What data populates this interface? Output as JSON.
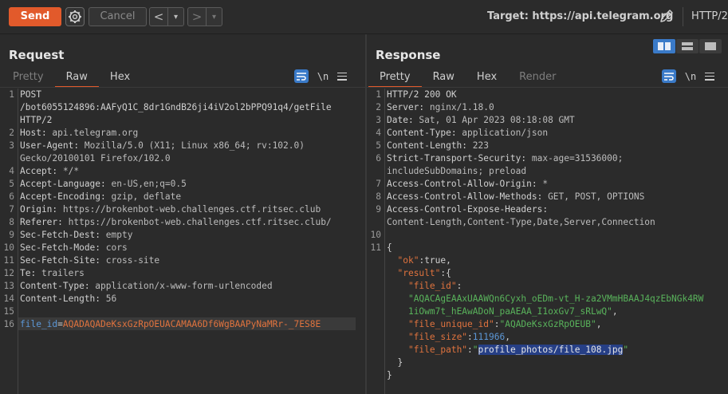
{
  "toolbar": {
    "send_label": "Send",
    "cancel_label": "Cancel",
    "back_label": "<",
    "forward_label": ">",
    "dropdown_glyph": "▾",
    "target_label": "Target: https://api.telegram.org",
    "http_version": "HTTP/2"
  },
  "request": {
    "title": "Request",
    "tabs": [
      "Pretty",
      "Raw",
      "Hex"
    ],
    "active_tab": "Raw",
    "newline_icon": "\\n",
    "lines": [
      {
        "n": "1",
        "k": "POST",
        "v": ""
      },
      {
        "n": "",
        "k": "/bot6055124896:AAFyQ1C_8dr1GndB26ji4iV2ol2bPPQ91q4/getFile",
        "v": ""
      },
      {
        "n": "",
        "k": "HTTP/2",
        "v": ""
      },
      {
        "n": "2",
        "k": "Host:",
        "v": " api.telegram.org"
      },
      {
        "n": "3",
        "k": "User-Agent:",
        "v": " Mozilla/5.0 (X11; Linux x86_64; rv:102.0)"
      },
      {
        "n": "",
        "k": "",
        "v": "Gecko/20100101 Firefox/102.0"
      },
      {
        "n": "4",
        "k": "Accept:",
        "v": " */*"
      },
      {
        "n": "5",
        "k": "Accept-Language:",
        "v": " en-US,en;q=0.5"
      },
      {
        "n": "6",
        "k": "Accept-Encoding:",
        "v": " gzip, deflate"
      },
      {
        "n": "7",
        "k": "Origin:",
        "v": " https://brokenbot-web.challenges.ctf.ritsec.club"
      },
      {
        "n": "8",
        "k": "Referer:",
        "v": " https://brokenbot-web.challenges.ctf.ritsec.club/"
      },
      {
        "n": "9",
        "k": "Sec-Fetch-Dest:",
        "v": " empty"
      },
      {
        "n": "10",
        "k": "Sec-Fetch-Mode:",
        "v": " cors"
      },
      {
        "n": "11",
        "k": "Sec-Fetch-Site:",
        "v": " cross-site"
      },
      {
        "n": "12",
        "k": "Te:",
        "v": " trailers"
      },
      {
        "n": "13",
        "k": "Content-Type:",
        "v": " application/x-www-form-urlencoded"
      },
      {
        "n": "14",
        "k": "Content-Length:",
        "v": " 56"
      },
      {
        "n": "15",
        "k": "",
        "v": ""
      }
    ],
    "body_line": {
      "n": "16",
      "param_name": "file_id",
      "equals": "=",
      "param_value": "AQADAQADeKsxGzRpOEUACAMAA6Df6WgBAAPyNaMRr-_7ES8E"
    }
  },
  "response": {
    "title": "Response",
    "tabs": [
      "Pretty",
      "Raw",
      "Hex",
      "Render"
    ],
    "active_tab": "Pretty",
    "newline_icon": "\\n",
    "header_lines": [
      {
        "n": "1",
        "k": "HTTP/2 200 OK",
        "v": ""
      },
      {
        "n": "2",
        "k": "Server:",
        "v": " nginx/1.18.0"
      },
      {
        "n": "3",
        "k": "Date:",
        "v": " Sat, 01 Apr 2023 08:18:08 GMT"
      },
      {
        "n": "4",
        "k": "Content-Type:",
        "v": " application/json"
      },
      {
        "n": "5",
        "k": "Content-Length:",
        "v": " 223"
      },
      {
        "n": "6",
        "k": "Strict-Transport-Security:",
        "v": " max-age=31536000;"
      },
      {
        "n": "",
        "k": "",
        "v": "includeSubDomains; preload"
      },
      {
        "n": "7",
        "k": "Access-Control-Allow-Origin:",
        "v": " *"
      },
      {
        "n": "8",
        "k": "Access-Control-Allow-Methods:",
        "v": " GET, POST, OPTIONS"
      },
      {
        "n": "9",
        "k": "Access-Control-Expose-Headers:",
        "v": ""
      },
      {
        "n": "",
        "k": "",
        "v": "Content-Length,Content-Type,Date,Server,Connection"
      },
      {
        "n": "10",
        "k": "",
        "v": ""
      }
    ],
    "json": {
      "line_no": "11",
      "open_brace": "{",
      "ok_key": "\"ok\"",
      "ok_val": "true",
      "result_key": "\"result\"",
      "file_id_key": "\"file_id\"",
      "file_id_val_1": "\"AQACAgEAAxUAAWQn6Cyxh_oEDm-vt_H-za2VMmHBAAJ4qzEbNGk4RW",
      "file_id_val_2": "1iOwm7t_hEAwADoN_paAEAA_I1oxGv7_sRLwQ\"",
      "file_unique_id_key": "\"file_unique_id\"",
      "file_unique_id_val": "\"AQADeKsxGzRpOEUB\"",
      "file_size_key": "\"file_size\"",
      "file_size_val": "111966",
      "file_path_key": "\"file_path\"",
      "file_path_quote_open": "\"",
      "file_path_val": "profile_photos/file_108.jpg",
      "file_path_quote_close": "\"",
      "close_inner": "}",
      "close_outer": "}"
    }
  },
  "colors": {
    "accent": "#e25a2b",
    "selection": "#263f86",
    "active_toggle": "#3a7ac8"
  }
}
